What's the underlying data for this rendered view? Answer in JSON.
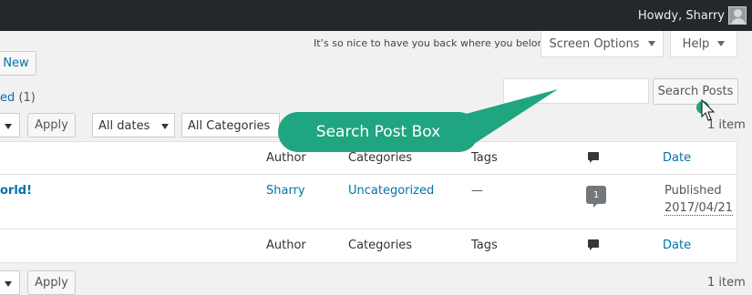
{
  "adminbar": {
    "howdy": "Howdy, Sharry",
    "avatar_icon": "user-avatar-icon"
  },
  "header": {
    "welcome": "It’s so nice to have you back where you belong",
    "screen_options": "Screen Options",
    "help": "Help"
  },
  "actions": {
    "add_new": "New"
  },
  "filters_links": {
    "published": "ed",
    "published_count": "(1)"
  },
  "search": {
    "placeholder": "",
    "button": "Search Posts"
  },
  "bulk_top": {
    "apply": "Apply",
    "dates": "All dates",
    "categories": "All Categories",
    "items": "1 item"
  },
  "table": {
    "columns": {
      "author": "Author",
      "categories": "Categories",
      "tags": "Tags",
      "comments_icon": "comment-icon",
      "date": "Date"
    },
    "rows": [
      {
        "title": "orld!",
        "author": "Sharry",
        "category": "Uncategorized",
        "tags": "—",
        "comments": "1",
        "status": "Published",
        "date": "2017/04/21"
      }
    ]
  },
  "bulk_bottom": {
    "apply": "Apply",
    "items": "1 item"
  },
  "callout": {
    "label": "Search Post Box",
    "color": "#1fa57f"
  }
}
